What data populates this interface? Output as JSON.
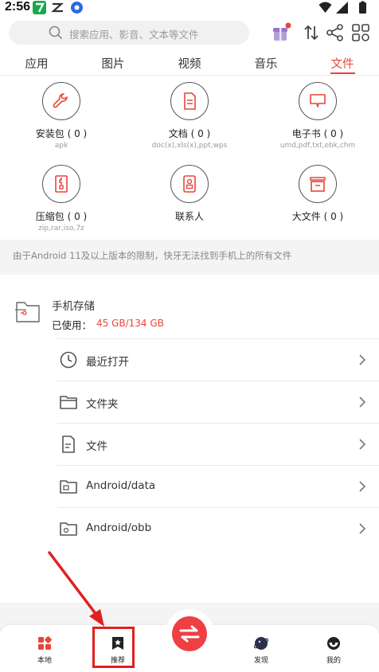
{
  "status_bar": {
    "time": "2:56"
  },
  "header": {
    "search_placeholder": "搜索应用、影音、文本等文件"
  },
  "tabs": [
    {
      "label": "应用",
      "active": false
    },
    {
      "label": "图片",
      "active": false
    },
    {
      "label": "视频",
      "active": false
    },
    {
      "label": "音乐",
      "active": false
    },
    {
      "label": "文件",
      "active": true
    }
  ],
  "categories": [
    {
      "label": "安装包 ( 0 )",
      "sub": "apk",
      "icon": "wrench-icon"
    },
    {
      "label": "文档 ( 0 )",
      "sub": "doc(x),xls(x),ppt,wps",
      "icon": "document-icon"
    },
    {
      "label": "电子书 ( 0 )",
      "sub": "umd,pdf,txt,ebk,chm",
      "icon": "ebook-icon"
    },
    {
      "label": "压缩包 ( 0 )",
      "sub": "zip,rar,iso,7z",
      "icon": "archive-icon"
    },
    {
      "label": "联系人",
      "sub": "",
      "icon": "contacts-icon"
    },
    {
      "label": "大文件 ( 0 )",
      "sub": "",
      "icon": "large-file-icon"
    }
  ],
  "notice": "由于Android 11及以上版本的限制，快牙无法找到手机上的所有文件",
  "storage": {
    "title": "手机存储",
    "used_label": "已使用：",
    "used_value": "45 GB/134 GB",
    "rows": [
      {
        "label": "最近打开",
        "icon": "clock-icon"
      },
      {
        "label": "文件夹",
        "icon": "folder-icon"
      },
      {
        "label": "文件",
        "icon": "file-icon"
      },
      {
        "label": "Android/data",
        "icon": "folder-data-icon"
      },
      {
        "label": "Android/obb",
        "icon": "folder-obb-icon"
      }
    ]
  },
  "bottom_nav": [
    {
      "label": "本地",
      "icon": "local-icon"
    },
    {
      "label": "推荐",
      "icon": "recommend-icon"
    },
    {
      "label": "发现",
      "icon": "discover-icon"
    },
    {
      "label": "我的",
      "icon": "profile-icon"
    }
  ],
  "colors": {
    "accent": "#e8453c",
    "highlight": "#e0201e"
  }
}
